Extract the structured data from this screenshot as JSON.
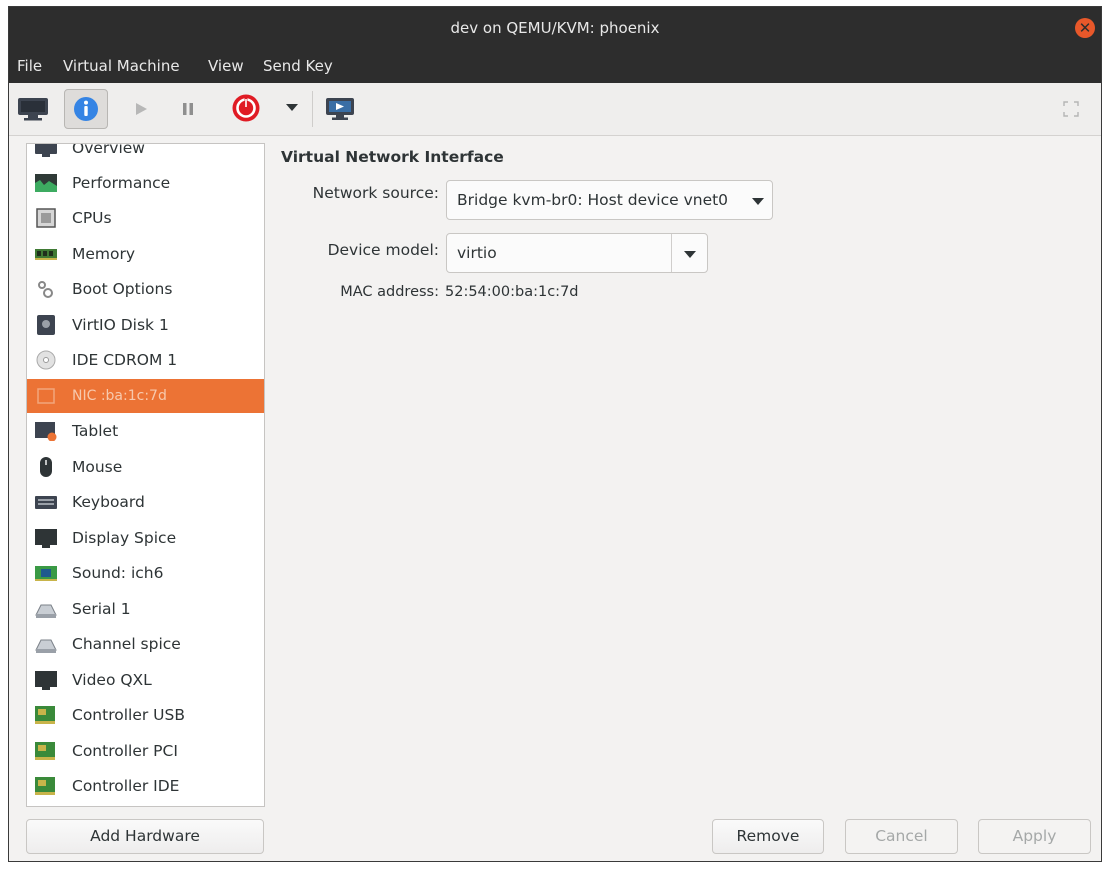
{
  "window": {
    "title": "dev on QEMU/KVM: phoenix"
  },
  "menu": [
    "File",
    "Virtual Machine",
    "View",
    "Send Key"
  ],
  "toolbar": {
    "icons": [
      "console-icon",
      "info-icon",
      "play-icon",
      "pause-icon",
      "power-icon",
      "dropdown-icon",
      "fullscreen-console-icon",
      "resize-icon"
    ]
  },
  "sidebar": {
    "items": [
      {
        "label": "Overview",
        "icon": "monitor-icon"
      },
      {
        "label": "Performance",
        "icon": "performance-graph-icon"
      },
      {
        "label": "CPUs",
        "icon": "cpu-chip-icon"
      },
      {
        "label": "Memory",
        "icon": "memory-stick-icon"
      },
      {
        "label": "Boot Options",
        "icon": "gears-icon"
      },
      {
        "label": "VirtIO Disk 1",
        "icon": "disk-icon"
      },
      {
        "label": "IDE CDROM 1",
        "icon": "cdrom-icon"
      },
      {
        "label": "NIC :ba:1c:7d",
        "icon": "network-card-icon",
        "selected": true
      },
      {
        "label": "Tablet",
        "icon": "tablet-icon"
      },
      {
        "label": "Mouse",
        "icon": "mouse-icon"
      },
      {
        "label": "Keyboard",
        "icon": "keyboard-icon"
      },
      {
        "label": "Display Spice",
        "icon": "display-icon"
      },
      {
        "label": "Sound: ich6",
        "icon": "sound-card-icon"
      },
      {
        "label": "Serial 1",
        "icon": "serial-port-icon"
      },
      {
        "label": "Channel spice",
        "icon": "channel-icon"
      },
      {
        "label": "Video QXL",
        "icon": "video-icon"
      },
      {
        "label": "Controller USB",
        "icon": "controller-card-icon"
      },
      {
        "label": "Controller PCI",
        "icon": "controller-card-icon"
      },
      {
        "label": "Controller IDE",
        "icon": "controller-card-icon"
      }
    ],
    "add_label": "Add Hardware"
  },
  "detail": {
    "title": "Virtual Network Interface",
    "network_source_label": "Network source:",
    "network_source_value": "Bridge kvm-br0: Host device vnet0",
    "device_model_label": "Device model:",
    "device_model_value": "virtio",
    "mac_label": "MAC address:",
    "mac_value": "52:54:00:ba:1c:7d"
  },
  "buttons": {
    "remove": "Remove",
    "cancel": "Cancel",
    "apply": "Apply"
  },
  "colors": {
    "titlebar": "#2d2d2d",
    "selection": "#ec7335",
    "close": "#e8582a",
    "info_blue": "#3584e4",
    "power_red": "#e01b24"
  }
}
